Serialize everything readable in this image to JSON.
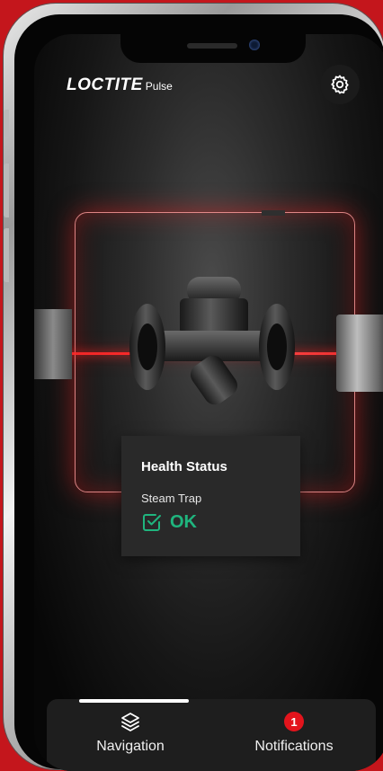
{
  "brand": {
    "logo_main": "LOCTITE",
    "logo_sub": "Pulse"
  },
  "header": {
    "settings_icon": "gear-icon"
  },
  "device": {
    "icon": "steam-trap-image"
  },
  "health_card": {
    "title": "Health Status",
    "device_name": "Steam Trap",
    "status_text": "OK",
    "status_icon": "check-square-icon",
    "status_color": "#1fb57e"
  },
  "bottom_nav": {
    "items": [
      {
        "label": "Navigation",
        "icon": "layers-icon",
        "active": true
      },
      {
        "label": "Notifications",
        "icon": "notification-badge",
        "badge_count": "1"
      }
    ]
  },
  "colors": {
    "accent_red": "#c4161c",
    "laser_red": "#ff2a2a",
    "badge_red": "#e3141c",
    "ok_green": "#1fb57e"
  }
}
